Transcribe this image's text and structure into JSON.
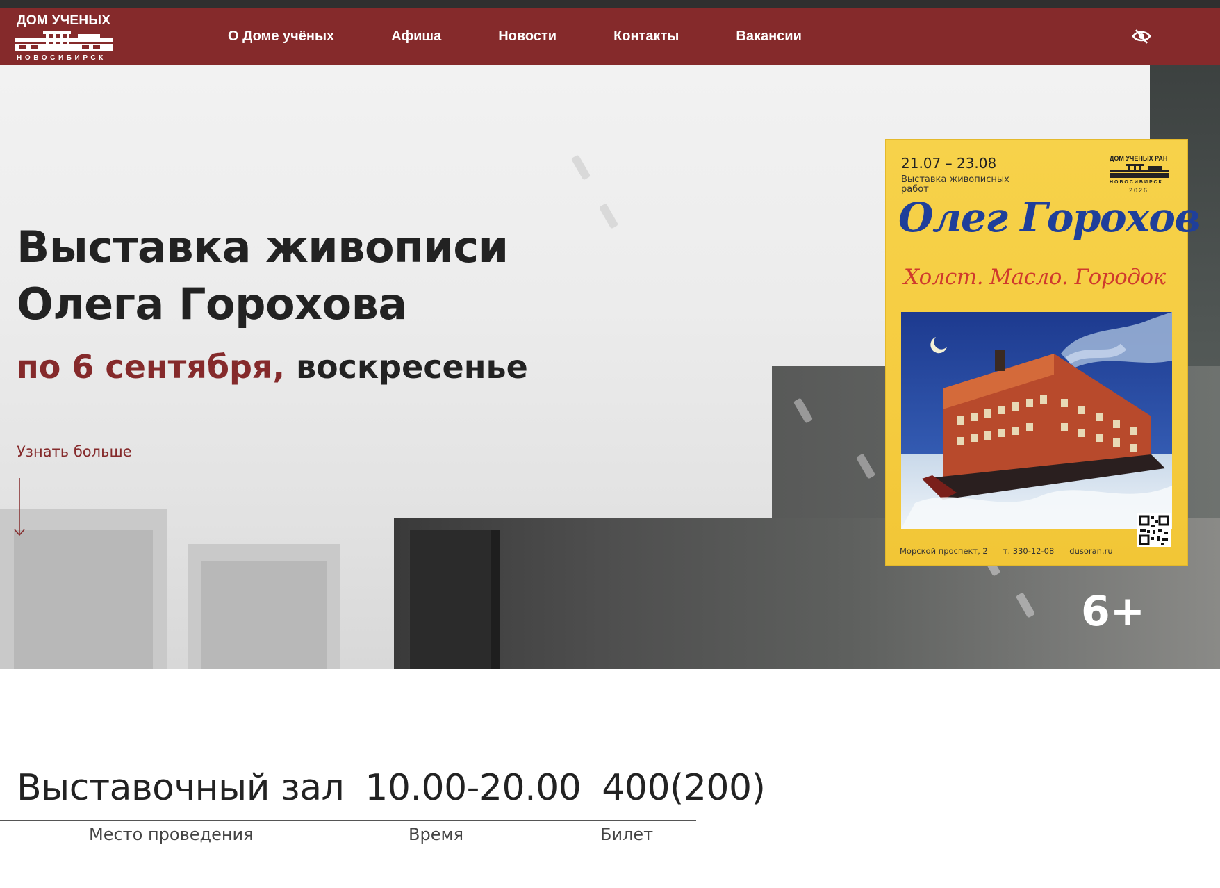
{
  "header": {
    "logo_title": "ДОМ УЧЕНЫХ",
    "logo_city": "НОВОСИБИРСК",
    "nav": [
      {
        "label": "О Доме учёных"
      },
      {
        "label": "Афиша"
      },
      {
        "label": "Новости"
      },
      {
        "label": "Контакты"
      },
      {
        "label": "Вакансии"
      }
    ],
    "accessibility_icon": "eye-slash-icon",
    "background_color": "#852a2b"
  },
  "hero": {
    "title": "Выставка живописи Олега Горохова",
    "date_highlight": "по 6 сентября,",
    "date_rest": " воскресенье",
    "learn_more": "Узнать больше",
    "age_rating": "6+",
    "accent_color": "#852a2b"
  },
  "poster": {
    "dates": "21.07 – 23.08",
    "subtitle": "Выставка живописных работ",
    "org": "ДОМ УЧЕНЫХ РАН",
    "org_city": "НОВОСИБИРСК",
    "year": "2026",
    "artist": "Олег Горохов",
    "tagline": "Холст. Масло. Городок",
    "address": "Морской проспект, 2",
    "phone": "т. 330-12-08",
    "site": "dusoran.ru"
  },
  "info": {
    "place_value": "Выставочный зал",
    "time_value": "10.00-20.00",
    "ticket_value": "400(200)",
    "place_label": "Место проведения",
    "time_label": "Время",
    "ticket_label": "Билет"
  }
}
